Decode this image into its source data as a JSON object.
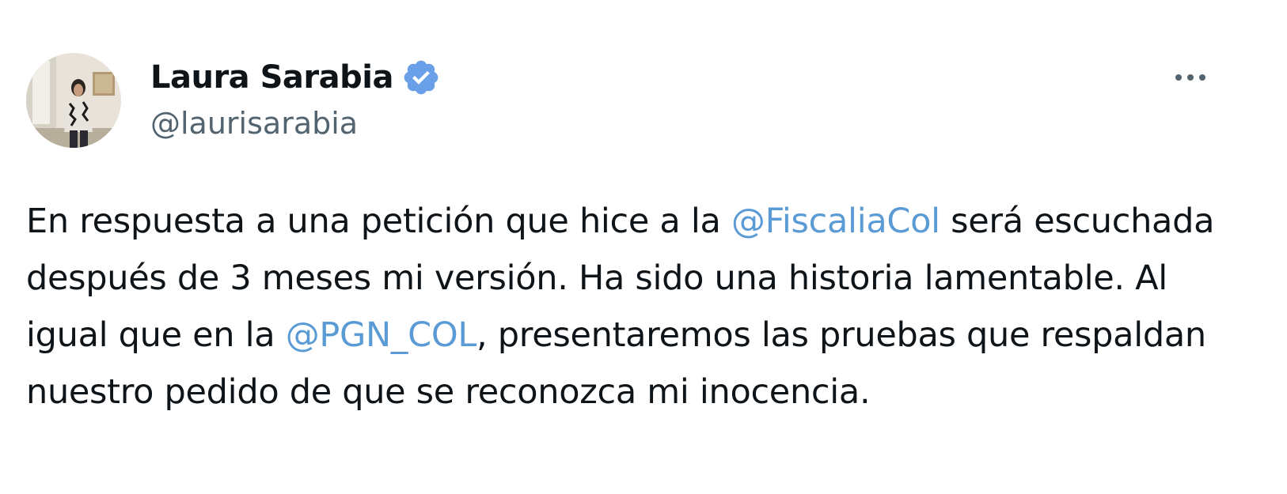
{
  "author": {
    "display_name": "Laura Sarabia",
    "handle": "@laurisarabia",
    "verified_icon": "verified-badge-icon",
    "avatar": "profile-photo"
  },
  "more_menu_icon": "more-horizontal-icon",
  "tweet": {
    "segments": [
      "En respuesta a una petición que hice a la ",
      "@FiscaliaCol",
      " será escuchada después de 3 meses mi versión. Ha sido una historia lamentable. Al igual que en la ",
      "@PGN_COL",
      ", presentaremos las pruebas que respaldan nuestro pedido de que se reconozca mi inocencia."
    ]
  },
  "colors": {
    "text": "#0f1419",
    "secondary": "#536471",
    "mention": "#5b9bd5",
    "verified": "#6aa0e8"
  }
}
